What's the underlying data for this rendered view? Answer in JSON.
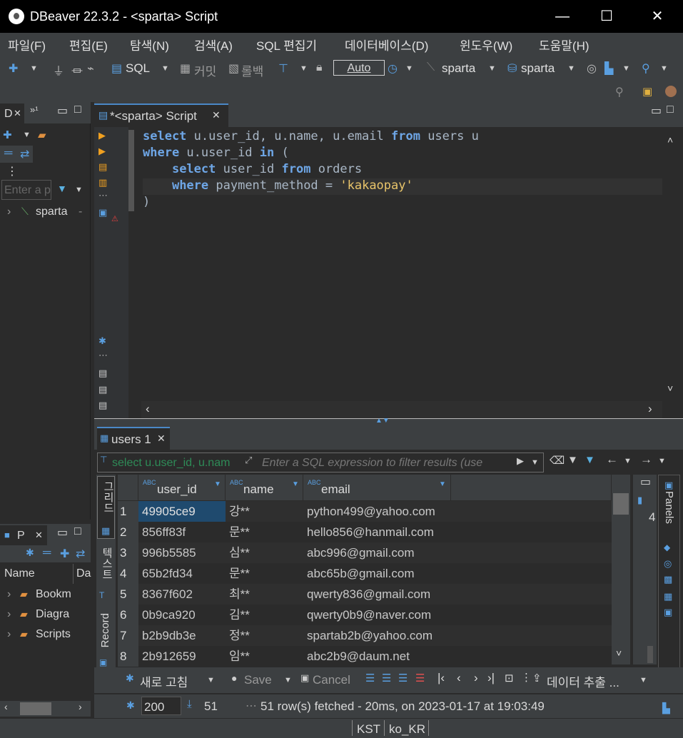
{
  "window": {
    "title": "DBeaver 22.3.2 - <sparta> Script",
    "minimize": "—",
    "maximize": "☐",
    "close": "✕"
  },
  "menu": [
    "파일(F)",
    "편집(E)",
    "탐색(N)",
    "검색(A)",
    "SQL 편집기",
    "데이터베이스(D)",
    "윈도우(W)",
    "도움말(H)"
  ],
  "toolbar": {
    "sql_label": "SQL",
    "commit_label": "커밋",
    "rollback_label": "롤백",
    "tx_mode": "Auto",
    "datasource": "sparta",
    "schema": "sparta"
  },
  "left": {
    "tab_label": "D",
    "filter_placeholder": "Enter a p",
    "tree_item": "sparta",
    "tree_suffix": "- ",
    "project_tab": "P",
    "col_name": "Name",
    "col_da": "Da",
    "projects": [
      "Bookm",
      "Diagra",
      "Scripts"
    ]
  },
  "editor": {
    "tab_label": "*<sparta> Script",
    "lines": [
      [
        [
          "kw",
          "select"
        ],
        [
          "t",
          " u.user_id, u.name, u.email "
        ],
        [
          "kw",
          "from"
        ],
        [
          "t",
          " users u"
        ]
      ],
      [
        [
          "kw",
          "where"
        ],
        [
          "t",
          " u.user_id "
        ],
        [
          "kw",
          "in"
        ],
        [
          "t",
          " ("
        ]
      ],
      [
        [
          "t",
          "    "
        ],
        [
          "kw",
          "select"
        ],
        [
          "t",
          " user_id "
        ],
        [
          "kw",
          "from"
        ],
        [
          "t",
          " orders"
        ]
      ],
      [
        [
          "t",
          "    "
        ],
        [
          "kw",
          "where"
        ],
        [
          "t",
          " payment_method = "
        ],
        [
          "str",
          "'kakaopay'"
        ]
      ],
      [
        [
          "t",
          ")"
        ]
      ]
    ]
  },
  "results": {
    "tab_label": "users 1",
    "filter_query": "select u.user_id, u.nam",
    "filter_placeholder": "Enter a SQL expression to filter results (use",
    "columns": [
      {
        "label": "user_id",
        "type": "ABC"
      },
      {
        "label": "name",
        "type": "ABC"
      },
      {
        "label": "email",
        "type": "ABC"
      }
    ],
    "rows": [
      [
        "1",
        "49905ce9",
        "강**",
        "python499@yahoo.com"
      ],
      [
        "2",
        "856ff83f",
        "문**",
        "hello856@hanmail.com"
      ],
      [
        "3",
        "996b5585",
        "심**",
        "abc996@gmail.com"
      ],
      [
        "4",
        "65b2fd34",
        "문**",
        "abc65b@gmail.com"
      ],
      [
        "5",
        "8367f602",
        "최**",
        "qwerty836@gmail.com"
      ],
      [
        "6",
        "0b9ca920",
        "김**",
        "qwerty0b9@naver.com"
      ],
      [
        "7",
        "b2b9db3e",
        "정**",
        "spartab2b@yahoo.com"
      ],
      [
        "8",
        "2b912659",
        "임**",
        "abc2b9@daum.net"
      ]
    ],
    "vertical_tabs": [
      "그리드",
      "텍스트",
      "Record"
    ],
    "panels_label": "Panels",
    "panel_value": "4",
    "bottom": {
      "refresh": "새로 고침",
      "save": "Save",
      "cancel": "Cancel",
      "export": "데이터 추출 ..."
    },
    "fetch_size": "200",
    "row_count": "51",
    "status": "51 row(s) fetched - 20ms, on 2023-01-17 at 19:03:49"
  },
  "statusbar": {
    "timezone": "KST",
    "locale": "ko_KR"
  }
}
